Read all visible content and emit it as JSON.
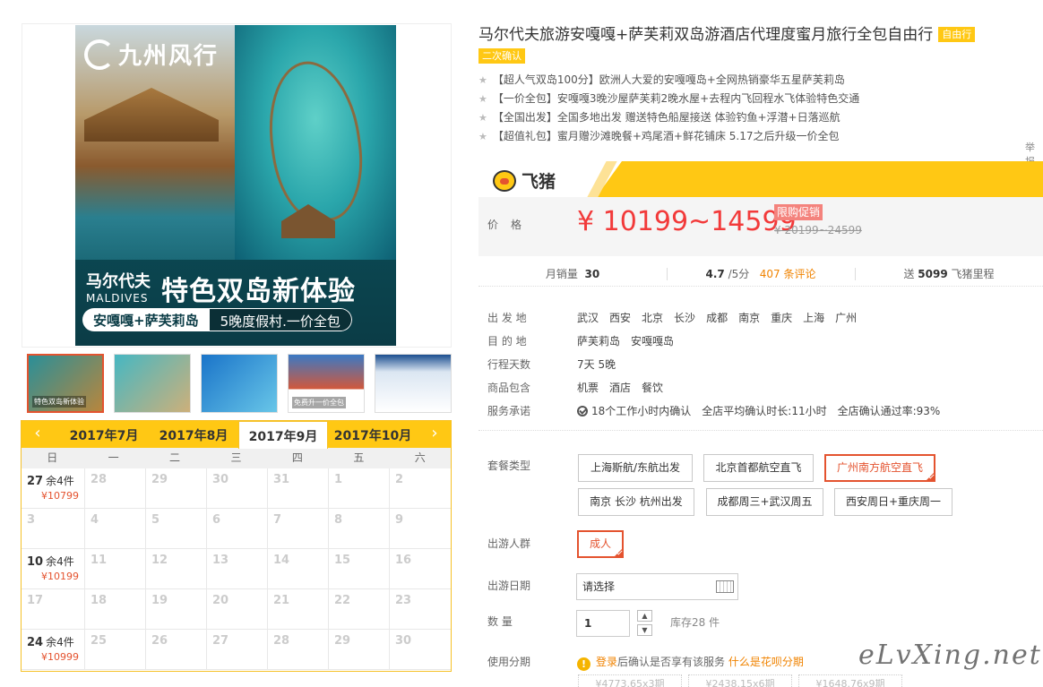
{
  "image": {
    "brand": "九州风行",
    "mald_cn": "马尔代夫",
    "mald_en": "MALDIVES",
    "headline": "特色双岛新体验",
    "pill_a": "安嘎嘎+萨芙莉岛",
    "pill_b": "5晚度假村.一价全包"
  },
  "thumbs": [
    {
      "label": "特色双岛新体验",
      "active": true
    },
    {
      "label": "",
      "active": false
    },
    {
      "label": "",
      "active": false
    },
    {
      "label": "免费升一价全包",
      "active": false
    },
    {
      "label": "",
      "active": false
    }
  ],
  "calendar": {
    "months": [
      "2017年7月",
      "2017年8月",
      "2017年9月",
      "2017年10月"
    ],
    "active_month": "2017年9月",
    "prev_arrow": "‹",
    "next_arrow": "›",
    "weekdays": [
      "日",
      "一",
      "二",
      "三",
      "四",
      "五",
      "六"
    ],
    "cells": [
      {
        "d": "27",
        "left": "余4件",
        "price": "¥10799",
        "avail": true
      },
      {
        "d": "28"
      },
      {
        "d": "29"
      },
      {
        "d": "30"
      },
      {
        "d": "31"
      },
      {
        "d": "1"
      },
      {
        "d": "2"
      },
      {
        "d": "3"
      },
      {
        "d": "4"
      },
      {
        "d": "5"
      },
      {
        "d": "6"
      },
      {
        "d": "7"
      },
      {
        "d": "8"
      },
      {
        "d": "9"
      },
      {
        "d": "10",
        "left": "余4件",
        "price": "¥10199",
        "avail": true
      },
      {
        "d": "11"
      },
      {
        "d": "12"
      },
      {
        "d": "13"
      },
      {
        "d": "14"
      },
      {
        "d": "15"
      },
      {
        "d": "16"
      },
      {
        "d": "17"
      },
      {
        "d": "18"
      },
      {
        "d": "19"
      },
      {
        "d": "20"
      },
      {
        "d": "21"
      },
      {
        "d": "22"
      },
      {
        "d": "23"
      },
      {
        "d": "24",
        "left": "余4件",
        "price": "¥10999",
        "avail": true
      },
      {
        "d": "25"
      },
      {
        "d": "26"
      },
      {
        "d": "27"
      },
      {
        "d": "28"
      },
      {
        "d": "29"
      },
      {
        "d": "30"
      }
    ]
  },
  "product": {
    "title": "马尔代夫旅游安嘎嘎+萨芙莉双岛游酒店代理度蜜月旅行全包自由行",
    "tag1": "自由行",
    "tag2": "二次确认",
    "features": [
      "【超人气双岛100分】欧洲人大爱的安嘎嘎岛+全网热销豪华五星萨芙莉岛",
      "【一价全包】安嘎嘎3晚沙屋萨芙莉2晚水屋+去程内飞回程水飞体验特色交通",
      "【全国出发】全国多地出发 赠送特色船屋接送 体验钓鱼+浮潜+日落巡航",
      "【超值礼包】蜜月赠沙滩晚餐+鸡尾酒+鲜花铺床 5.17之后升级一价全包"
    ],
    "report": "举报"
  },
  "price": {
    "brand": "飞猪",
    "label": "价格",
    "current": "¥ 10199~14599",
    "promo": "限购促销",
    "original": "¥ 20199~24599"
  },
  "stats": {
    "sales_label": "月销量",
    "sales": "30",
    "rating": "4.7",
    "rating_unit": "/5分",
    "reviews": "407 条评论",
    "miles_prefix": "送",
    "miles": "5099",
    "miles_suffix": "飞猪里程"
  },
  "attrs": {
    "depart_label": "出 发 地",
    "depart": [
      "武汉",
      "西安",
      "北京",
      "长沙",
      "成都",
      "南京",
      "重庆",
      "上海",
      "广州"
    ],
    "dest_label": "目 的 地",
    "dest": [
      "萨芙莉岛",
      "安嘎嘎岛"
    ],
    "days_label": "行程天数",
    "days": "7天 5晚",
    "incl_label": "商品包含",
    "incl": [
      "机票",
      "酒店",
      "餐饮"
    ],
    "promise_label": "服务承诺",
    "promise": [
      "18个工作小时内确认",
      "全店平均确认时长:11小时",
      "全店确认通过率:93%"
    ]
  },
  "options": {
    "pkg_label": "套餐类型",
    "packages": [
      "上海斯航/东航出发",
      "北京首都航空直飞",
      "广州南方航空直飞",
      "南京 长沙 杭州出发",
      "成都周三+武汉周五",
      "西安周日+重庆周一"
    ],
    "pkg_selected": "广州南方航空直飞",
    "crowd_label": "出游人群",
    "crowd": "成人",
    "date_label": "出游日期",
    "date_value": "请选择",
    "qty_label": "数 量",
    "qty": "1",
    "stock": "库存28 件",
    "install_label": "使用分期",
    "install_login": "登录",
    "install_text": "后确认是否享有该服务",
    "install_link": "什么是花呗分期",
    "plans": [
      "¥4773.65x3期",
      "¥2438.15x6期",
      "¥1648.76x9期"
    ]
  },
  "watermark": "eLvXing.net",
  "colors": {
    "accent": "#ffc814",
    "price": "#f23a3a",
    "select": "#e4532f"
  }
}
